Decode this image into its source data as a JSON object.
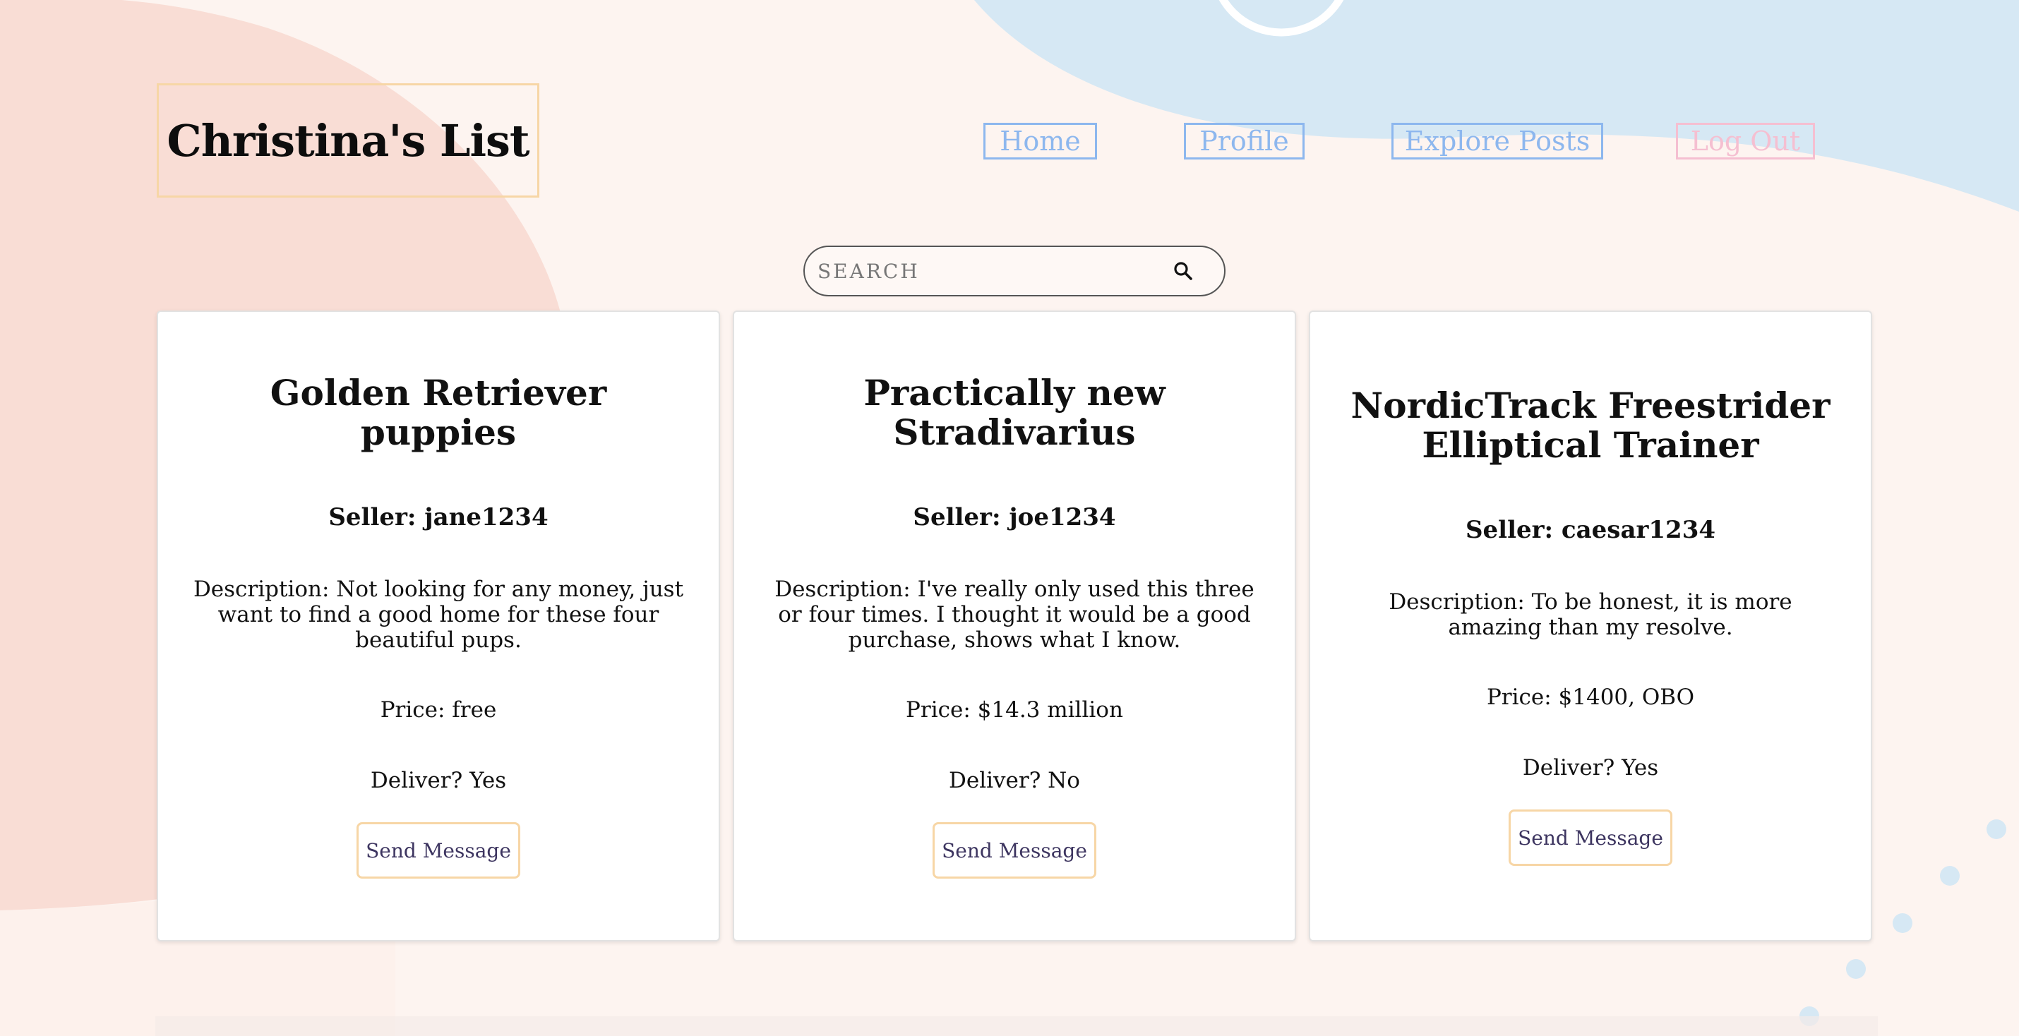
{
  "header": {
    "logo": "Christina's List"
  },
  "nav": {
    "home": "Home",
    "profile": "Profile",
    "explore": "Explore Posts",
    "logout": "Log Out"
  },
  "search": {
    "placeholder": "SEARCH",
    "icon": "search-icon"
  },
  "colors": {
    "nav_blue": "#8db7ee",
    "logout_pink": "#f5bfd1",
    "accent_peach": "#f7d6a6",
    "button_text": "#3d3560"
  },
  "posts": [
    {
      "title": "Golden Retriever puppies",
      "seller": "Seller: jane1234",
      "description": "Description: Not looking for any money, just want to find a good home for these four beautiful pups.",
      "price": "Price: free",
      "deliver": "Deliver? Yes",
      "button": "Send Message"
    },
    {
      "title": "Practically new Stradivarius",
      "seller": "Seller: joe1234",
      "description": "Description: I've really only used this three or four times. I thought it would be a good purchase, shows what I know.",
      "price": "Price: $14.3 million",
      "deliver": "Deliver? No",
      "button": "Send Message"
    },
    {
      "title": "NordicTrack Freestrider Elliptical Trainer",
      "seller": "Seller: caesar1234",
      "description": "Description: To be honest, it is more amazing than my resolve.",
      "price": "Price: $1400, OBO",
      "deliver": "Deliver? Yes",
      "button": "Send Message"
    }
  ]
}
